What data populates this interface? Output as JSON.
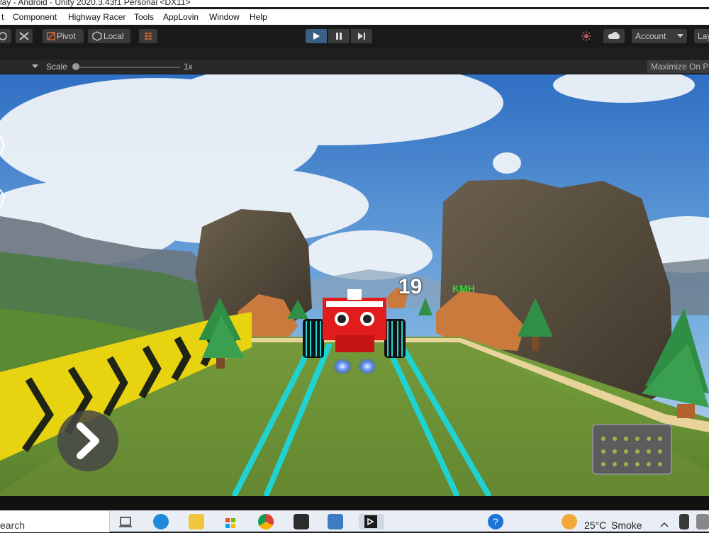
{
  "window": {
    "title": "lay - Android - Unity 2020.3.43f1 Personal <DX11>"
  },
  "menu": {
    "items": [
      "t",
      "Component",
      "Highway Racer",
      "Tools",
      "AppLovin",
      "Window",
      "Help"
    ]
  },
  "toolbar": {
    "pivot_label": "Pivot",
    "local_label": "Local",
    "account_label": "Account",
    "layers_label": "Lay"
  },
  "game_view": {
    "scale_label": "Scale",
    "scale_value": "1x",
    "maximize_label": "Maximize On P"
  },
  "hud": {
    "speed": "19",
    "speed_unit": "KMH"
  },
  "taskbar": {
    "search_text": "earch",
    "temperature": "25°C",
    "weather": "Smoke"
  },
  "colors": {
    "play_active": "#3b5e85",
    "track_lines": "#1fd3d3",
    "kmh_color": "#38d33e"
  }
}
